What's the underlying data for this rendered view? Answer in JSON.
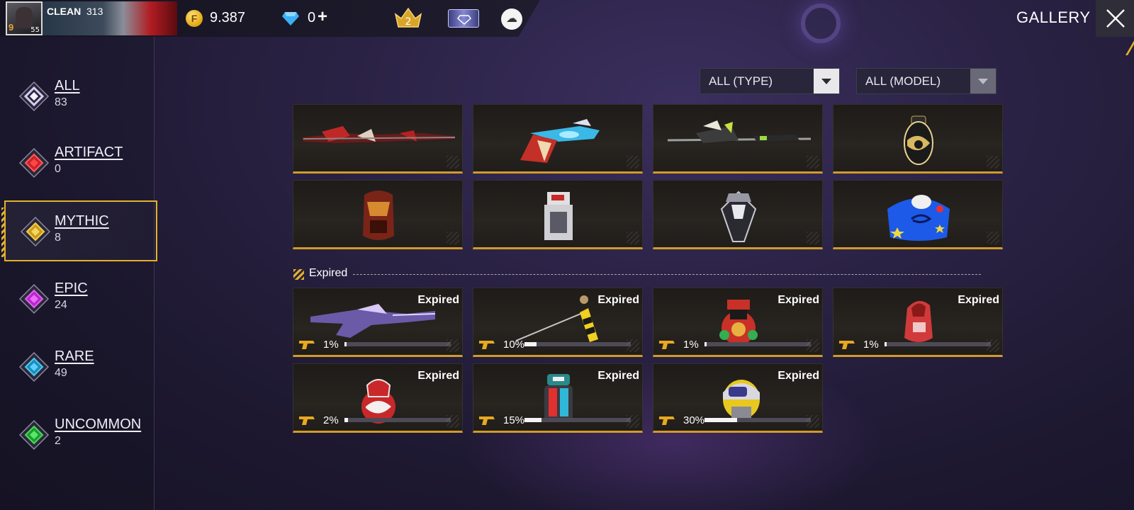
{
  "topbar": {
    "player_name": "CLEAN",
    "player_score": "313",
    "avatar_level": "55",
    "avatar_badge": "9",
    "gold": "9.387",
    "diamonds": "0",
    "diamond_add": "+",
    "rank_badge": "2",
    "gold_icon_letter": "F"
  },
  "header": {
    "title": "GALLERY"
  },
  "sidebar": {
    "items": [
      {
        "label": "ALL",
        "count": "83",
        "color": "#c9b8f0"
      },
      {
        "label": "ARTIFACT",
        "count": "0",
        "color": "#e02a2a"
      },
      {
        "label": "MYTHIC",
        "count": "8",
        "color": "#e0b52a"
      },
      {
        "label": "EPIC",
        "count": "24",
        "color": "#d83ae8"
      },
      {
        "label": "RARE",
        "count": "49",
        "color": "#2aa6d8"
      },
      {
        "label": "UNCOMMON",
        "count": "2",
        "color": "#2ab43a"
      }
    ],
    "active_index": 2
  },
  "filters": {
    "type": "ALL (TYPE)",
    "model": "ALL (MODEL)"
  },
  "owned_items": [
    {
      "icon": "red-sniper-rifle"
    },
    {
      "icon": "blue-red-blaster-pistol"
    },
    {
      "icon": "green-white-spear-rifle"
    },
    {
      "icon": "black-gold-grenade"
    },
    {
      "icon": "red-gold-backpack"
    },
    {
      "icon": "white-red-robot-backpack"
    },
    {
      "icon": "silver-crystal-backpack"
    },
    {
      "icon": "blue-star-vehicle-skin"
    }
  ],
  "expired_section": {
    "title": "Expired",
    "items": [
      {
        "icon": "purple-assault-rifle",
        "tag": "Expired",
        "percent": "1%",
        "progress": 0.01
      },
      {
        "icon": "yellow-black-gold-staff",
        "tag": "Expired",
        "percent": "10%",
        "progress": 0.1
      },
      {
        "icon": "red-robot-pet",
        "tag": "Expired",
        "percent": "1%",
        "progress": 0.01
      },
      {
        "icon": "red-hooded-backpack",
        "tag": "Expired",
        "percent": "1%",
        "progress": 0.01
      },
      {
        "icon": "red-white-bag",
        "tag": "Expired",
        "percent": "2%",
        "progress": 0.02
      },
      {
        "icon": "teal-red-backpack",
        "tag": "Expired",
        "percent": "15%",
        "progress": 0.15
      },
      {
        "icon": "yellow-robot-helmet",
        "tag": "Expired",
        "percent": "30%",
        "progress": 0.3
      }
    ]
  },
  "colors": {
    "accent_gold": "#e3b12b",
    "card_border": "#d29a2a",
    "background": "#2a2244"
  }
}
